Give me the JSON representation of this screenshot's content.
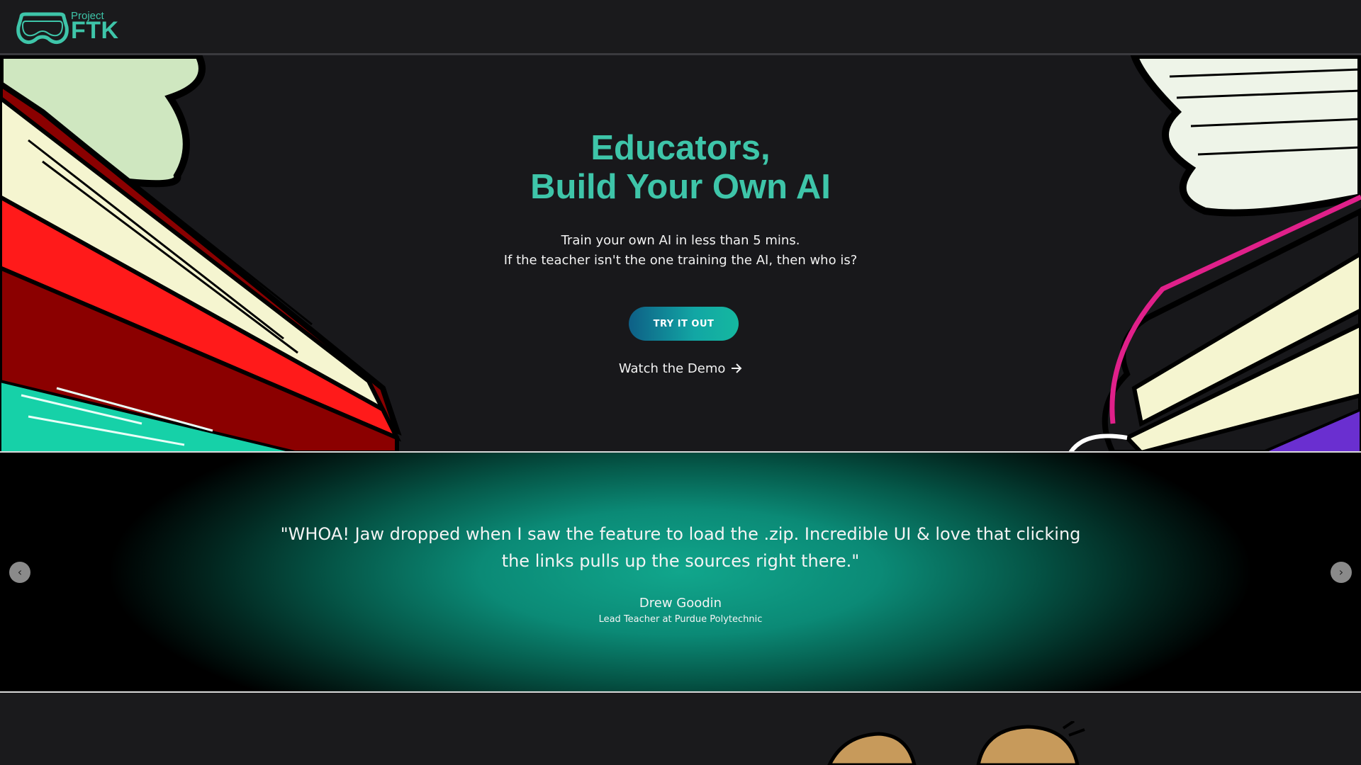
{
  "header": {
    "logo": {
      "project_label": "Project",
      "name_label": "FTK",
      "icon": "goggles-icon"
    }
  },
  "hero": {
    "title_line1": "Educators,",
    "title_line2": "Build Your Own AI",
    "subtitle_line1": "Train your own AI in less than 5 mins.",
    "subtitle_line2": "If the teacher isn't the one training the AI, then who is?",
    "cta_label": "TRY IT OUT",
    "demo_label": "Watch the Demo",
    "demo_icon": "arrow-right-icon",
    "accent_color": "#3ec5a9"
  },
  "testimonial": {
    "quote": "\"WHOA! Jaw dropped when I saw the feature to load the .zip. Incredible UI & love that clicking the links pulls up the sources right there.\"",
    "author_name": "Drew Goodin",
    "author_title": "Lead Teacher at Purdue Polytechnic",
    "prev_icon": "chevron-left-icon",
    "next_icon": "chevron-right-icon",
    "prev_glyph": "‹",
    "next_glyph": "›",
    "accent_color": "#11a68c"
  }
}
